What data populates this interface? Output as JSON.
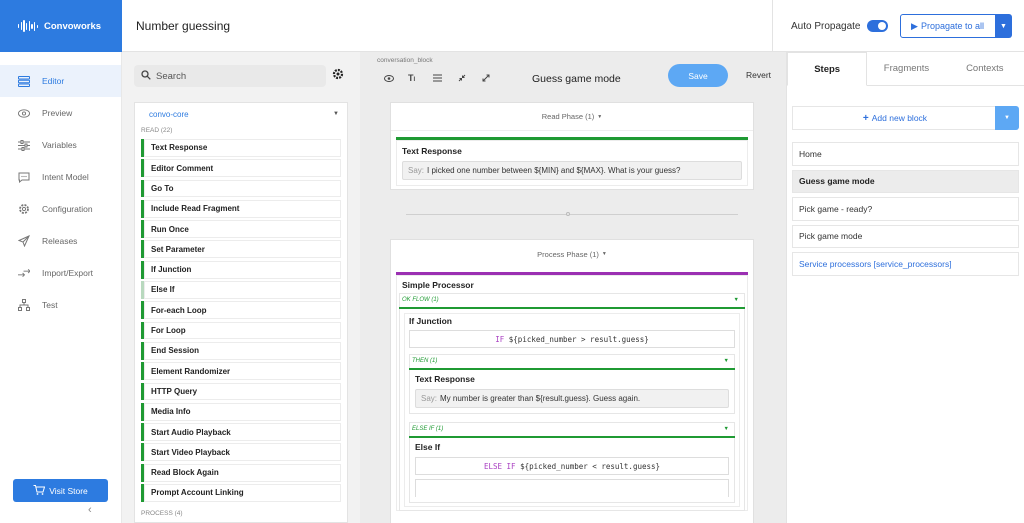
{
  "brand": {
    "name": "Convoworks"
  },
  "header": {
    "title": "Number guessing",
    "auto_propagate_label": "Auto Propagate",
    "auto_propagate_on": true,
    "propagate_label": "Propagate to all"
  },
  "sidebar": {
    "items": [
      {
        "label": "Editor",
        "icon": "editor-icon",
        "active": true
      },
      {
        "label": "Preview",
        "icon": "eye-icon"
      },
      {
        "label": "Variables",
        "icon": "sliders-icon"
      },
      {
        "label": "Intent Model",
        "icon": "chat-icon"
      },
      {
        "label": "Configuration",
        "icon": "gear-icon"
      },
      {
        "label": "Releases",
        "icon": "send-icon"
      },
      {
        "label": "Import/Export",
        "icon": "import-export-icon"
      },
      {
        "label": "Test",
        "icon": "tree-icon"
      }
    ],
    "visit_store": "Visit Store"
  },
  "components": {
    "search_placeholder": "Search",
    "package": "convo-core",
    "read_section": "READ (22)",
    "process_section": "PROCESS (4)",
    "items": [
      "Text Response",
      "Editor Comment",
      "Go To",
      "Include Read Fragment",
      "Run Once",
      "Set Parameter",
      "If Junction",
      "Else If",
      "For-each Loop",
      "For Loop",
      "End Session",
      "Element Randomizer",
      "HTTP Query",
      "Media Info",
      "Start Audio Playback",
      "Start Video Playback",
      "Read Block Again",
      "Prompt Account Linking"
    ]
  },
  "canvas": {
    "label": "conversation_block",
    "block_title": "Guess game mode",
    "save": "Save",
    "revert": "Revert",
    "read_phase": "Read Phase (1)",
    "read_el_title": "Text Response",
    "say_prefix": "Say:",
    "read_say": "I picked one number between ${MIN} and ${MAX}. What is your guess?",
    "process_phase": "Process Phase (1)",
    "processor_title": "Simple Processor",
    "ok_flow": "OK FLOW (1)",
    "if_title": "If Junction",
    "if_keyword": "IF",
    "if_expr": "${picked_number > result.guess}",
    "then_label": "THEN (1)",
    "then_el_title": "Text Response",
    "then_say": "My number is greater than ${result.guess}. Guess again.",
    "else_if_label": "ELSE IF (1)",
    "else_if_title": "Else If",
    "else_if_keyword": "ELSE IF",
    "else_if_expr": "${picked_number < result.guess}"
  },
  "right": {
    "tabs": [
      "Steps",
      "Fragments",
      "Contexts"
    ],
    "add_block": "Add new block",
    "steps": [
      {
        "label": "Home"
      },
      {
        "label": "Guess game mode",
        "active": true
      },
      {
        "label": "Pick game - ready?"
      },
      {
        "label": "Pick game mode"
      },
      {
        "label": "Service processors [service_processors]",
        "link": true
      }
    ]
  },
  "colors": {
    "brand": "#2d7be0",
    "accent_green": "#1f9a33",
    "accent_purple": "#9b30b2"
  }
}
